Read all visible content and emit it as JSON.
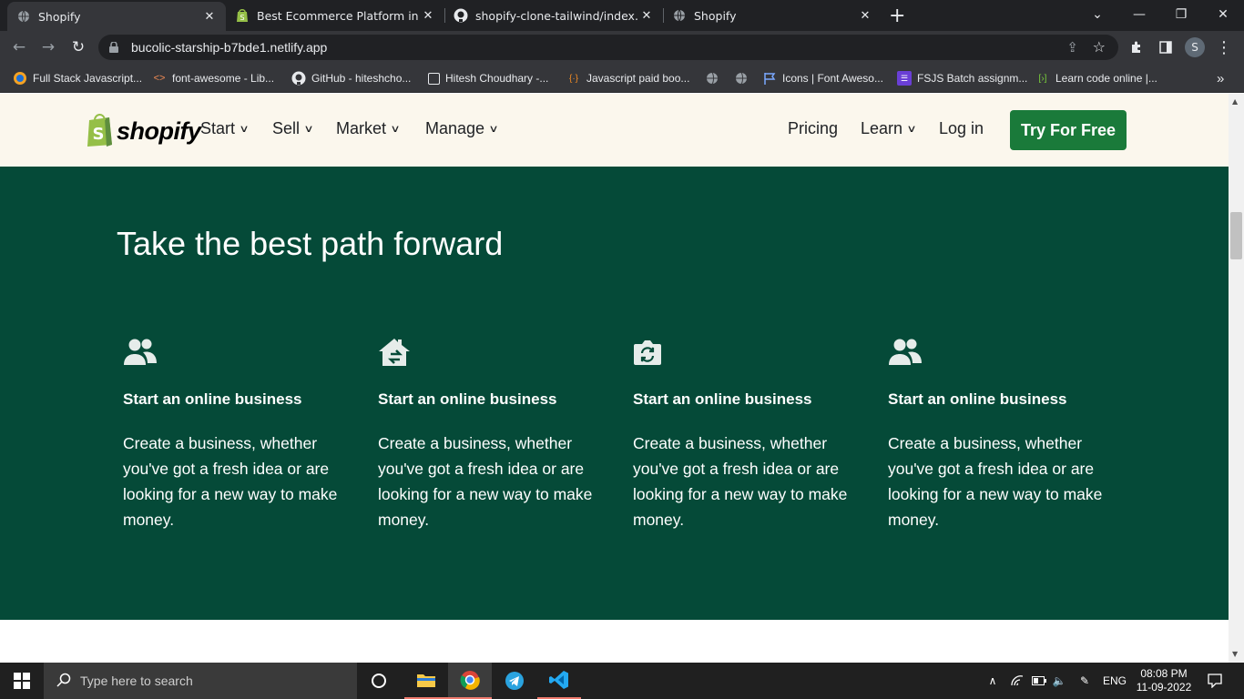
{
  "browser": {
    "tabs": [
      {
        "title": "Shopify",
        "icon": "globe-icon"
      },
      {
        "title": "Best Ecommerce Platform in India",
        "icon": "shopify-bag-icon"
      },
      {
        "title": "shopify-clone-tailwind/index.htm",
        "icon": "github-icon"
      },
      {
        "title": "Shopify",
        "icon": "globe-icon"
      }
    ],
    "new_tab": "+",
    "url": "bucolic-starship-b7bde1.netlify.app",
    "profile_initial": "S",
    "bookmarks": [
      {
        "label": "Full Stack Javascript...",
        "icon": "orange-circle-icon"
      },
      {
        "label": "font-awesome - Lib...",
        "icon": "code-brackets-icon"
      },
      {
        "label": "GitHub - hiteshcho...",
        "icon": "github-icon"
      },
      {
        "label": "Hitesh Choudhary -...",
        "icon": "square-icon"
      },
      {
        "label": "Javascript paid boo...",
        "icon": "braces-icon"
      },
      {
        "label": "",
        "icon": "globe-icon"
      },
      {
        "label": "",
        "icon": "globe-icon"
      },
      {
        "label": "Icons | Font Aweso...",
        "icon": "flag-icon"
      },
      {
        "label": "FSJS Batch assignm...",
        "icon": "list-icon"
      },
      {
        "label": "Learn code online |...",
        "icon": "code-icon"
      }
    ],
    "bookmarks_more": "»"
  },
  "site": {
    "logo_text": "shopify",
    "nav_left": [
      "Start",
      "Sell",
      "Market",
      "Manage"
    ],
    "nav_right": {
      "pricing": "Pricing",
      "learn": "Learn",
      "login": "Log in"
    },
    "cta": "Try For Free"
  },
  "hero": {
    "title": "Take the best path forward",
    "cards": [
      {
        "icon": "users-icon",
        "title": "Start an online business",
        "text": "Create a business, whether you've got a fresh idea or are looking for a new way to make money."
      },
      {
        "icon": "house-arrow-icon",
        "title": "Start an online business",
        "text": "Create a business, whether you've got a fresh idea or are looking for a new way to make money."
      },
      {
        "icon": "camera-rotate-icon",
        "title": "Start an online business",
        "text": "Create a business, whether you've got a fresh idea or are looking for a new way to make money."
      },
      {
        "icon": "users-icon",
        "title": "Start an online business",
        "text": "Create a business, whether you've got a fresh idea or are looking for a new way to make money."
      }
    ]
  },
  "taskbar": {
    "search_placeholder": "Type here to search",
    "lang": "ENG",
    "time": "08:08 PM",
    "date": "11-09-2022"
  },
  "colors": {
    "hero_bg": "#054a38",
    "nav_bg": "#fbf7ed",
    "cta_bg": "#1a7a3a",
    "chrome_dark": "#202124",
    "chrome_toolbar": "#35363a"
  }
}
